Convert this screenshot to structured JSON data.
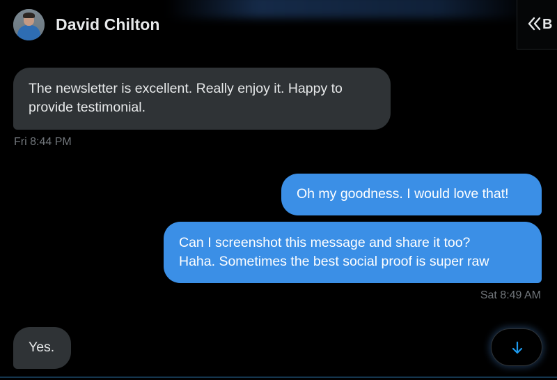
{
  "header": {
    "contact_name": "David Chilton",
    "collapse_label": "B"
  },
  "messages": [
    {
      "sender": "received",
      "text_line1": "The newsletter is excellent. Really enjoy it. Happy to",
      "text_line2": "provide testimonial."
    },
    {
      "sender": "sent",
      "text": "Oh my goodness. I would love that!"
    },
    {
      "sender": "sent",
      "text_line1": "Can I screenshot this message and share it too?",
      "text_line2": "Haha. Sometimes the best social proof is super raw"
    },
    {
      "sender": "received",
      "text": "Yes."
    }
  ],
  "timestamps": {
    "first": "Fri 8:44 PM",
    "second": "Sat 8:49 AM"
  },
  "icons": {
    "collapse": "double-chevron-left-icon",
    "scroll": "arrow-down-icon"
  },
  "colors": {
    "background": "#000000",
    "received_bubble": "#2f3336",
    "sent_bubble": "#3b8fe6",
    "timestamp": "#71767b",
    "accent": "#1d9bf0"
  }
}
